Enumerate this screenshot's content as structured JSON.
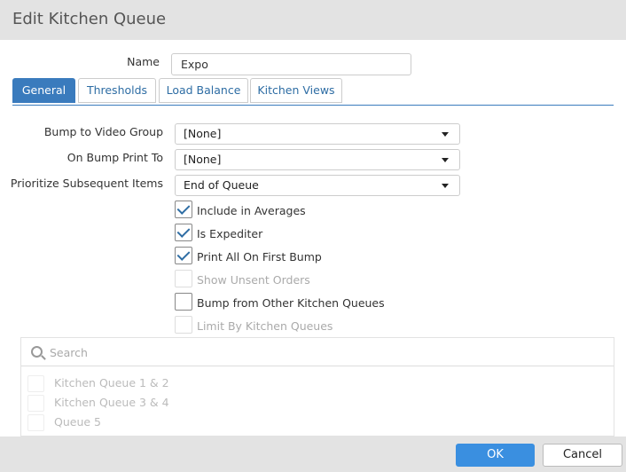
{
  "dialog": {
    "title": "Edit Kitchen Queue"
  },
  "name_field": {
    "label": "Name",
    "value": "Expo"
  },
  "tabs": [
    {
      "label": "General",
      "active": true
    },
    {
      "label": "Thresholds",
      "active": false
    },
    {
      "label": "Load Balance",
      "active": false
    },
    {
      "label": "Kitchen Views",
      "active": false
    }
  ],
  "fields": {
    "bump_to_video_group": {
      "label": "Bump to Video Group",
      "value": "[None]"
    },
    "on_bump_print_to": {
      "label": "On Bump Print To",
      "value": "[None]"
    },
    "prioritize_subsequent_items": {
      "label": "Prioritize Subsequent Items",
      "value": "End of Queue"
    }
  },
  "checkboxes": [
    {
      "label": "Include in Averages",
      "checked": true,
      "enabled": true
    },
    {
      "label": "Is Expediter",
      "checked": true,
      "enabled": true
    },
    {
      "label": "Print All On First Bump",
      "checked": true,
      "enabled": true
    },
    {
      "label": "Show Unsent Orders",
      "checked": false,
      "enabled": false
    },
    {
      "label": "Bump from Other Kitchen Queues",
      "checked": false,
      "enabled": true
    },
    {
      "label": "Limit By Kitchen Queues",
      "checked": false,
      "enabled": false
    }
  ],
  "queue_list": {
    "search_placeholder": "Search",
    "items": [
      "Kitchen Queue 1 & 2",
      "Kitchen Queue 3 & 4",
      "Queue 5"
    ]
  },
  "footer": {
    "ok_label": "OK",
    "cancel_label": "Cancel"
  },
  "colors": {
    "accent": "#3a7bbd",
    "ok_button": "#3a8fe0",
    "check": "#2e6da4"
  }
}
